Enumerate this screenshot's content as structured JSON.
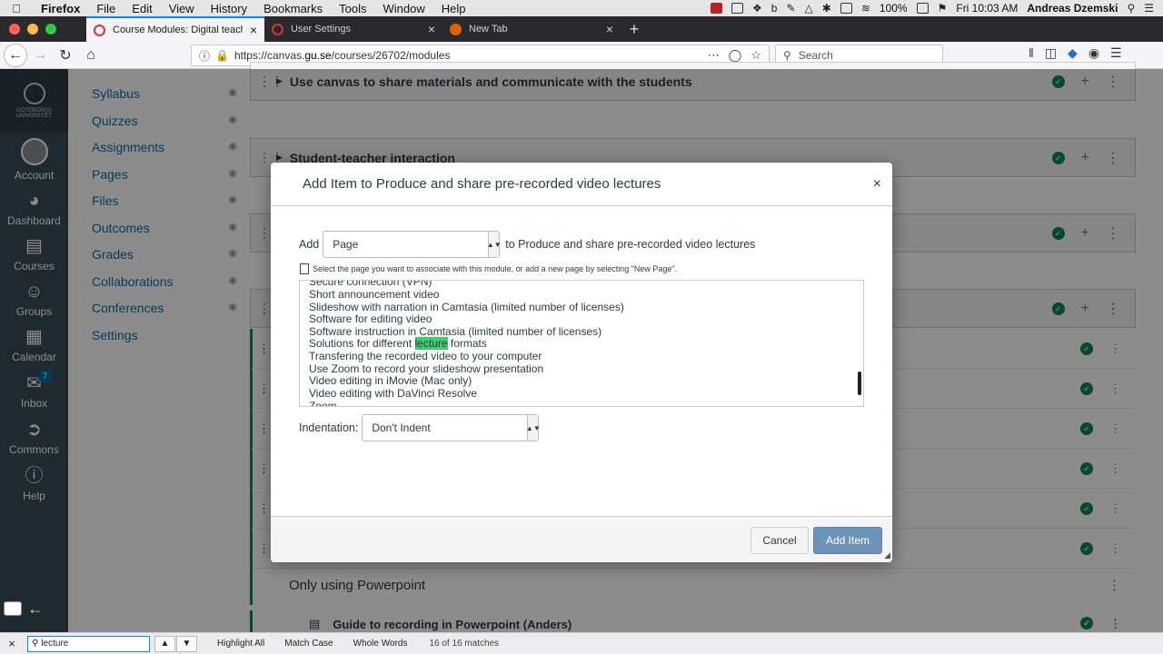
{
  "menubar": {
    "app": "Firefox",
    "items": [
      "File",
      "Edit",
      "View",
      "History",
      "Bookmarks",
      "Tools",
      "Window",
      "Help"
    ],
    "battery": "100%",
    "clock": "Fri 10:03 AM",
    "user": "Andreas Dzemski"
  },
  "tabs": [
    {
      "title": "Course Modules: Digital teachin",
      "active": true
    },
    {
      "title": "User Settings",
      "active": false
    },
    {
      "title": "New Tab",
      "active": false
    }
  ],
  "navbar": {
    "url_prefix": "https://canvas.",
    "url_host": "gu.se",
    "url_path": "/courses/26702/modules",
    "search_placeholder": "Search"
  },
  "global_nav": {
    "logo_text": "GÖTEBORGS UNIVERSITET",
    "items": [
      {
        "label": "Account",
        "icon": "avatar"
      },
      {
        "label": "Dashboard",
        "icon": "dashboard-icon"
      },
      {
        "label": "Courses",
        "icon": "courses-icon"
      },
      {
        "label": "Groups",
        "icon": "groups-icon"
      },
      {
        "label": "Calendar",
        "icon": "calendar-icon"
      },
      {
        "label": "Inbox",
        "icon": "inbox-icon",
        "badge": "7"
      },
      {
        "label": "Commons",
        "icon": "commons-icon"
      },
      {
        "label": "Help",
        "icon": "help-icon"
      }
    ]
  },
  "course_nav": {
    "items": [
      {
        "label": "Syllabus",
        "hidden": true
      },
      {
        "label": "Quizzes",
        "hidden": true
      },
      {
        "label": "Assignments",
        "hidden": true
      },
      {
        "label": "Pages",
        "hidden": true
      },
      {
        "label": "Files",
        "hidden": true
      },
      {
        "label": "Outcomes",
        "hidden": true
      },
      {
        "label": "Grades",
        "hidden": true
      },
      {
        "label": "Collaborations",
        "hidden": true
      },
      {
        "label": "Conferences",
        "hidden": true
      },
      {
        "label": "Settings",
        "hidden": false
      }
    ]
  },
  "modules": {
    "headers": [
      "Use canvas to share materials and communicate with the students",
      "Student-teacher interaction"
    ],
    "subheader": "Only using Powerpoint",
    "subitem": "Guide to recording in Powerpoint (Anders)"
  },
  "dialog": {
    "title": "Add Item to Produce and share pre-recorded video lectures",
    "close": "×",
    "add_label": "Add",
    "type_value": "Page",
    "add_suffix": "to Produce and share pre-recorded video lectures",
    "hint": "Select the page you want to associate with this module, or add a new page by selecting \"New Page\".",
    "options": [
      "Secure connection (VPN)",
      "Short announcement video",
      "Slideshow with narration in Camtasia (limited number of licenses)",
      "Software for editing video",
      "Software instruction in Camtasia (limited number of licenses)",
      "Solutions for different lecture formats",
      "Transfering the recorded video to your computer",
      "Use Zoom to record your slideshow presentation",
      "Video editing in iMovie (Mac only)",
      "Video editing with DaVinci Resolve",
      "Zoom"
    ],
    "highlight": {
      "before": "Solutions for different ",
      "match": "lecture",
      "after": " formats"
    },
    "indent_label": "Indentation:",
    "indent_value": "Don't Indent",
    "cancel": "Cancel",
    "submit": "Add Item"
  },
  "findbar": {
    "query": "lecture",
    "highlight_all": "Highlight All",
    "match_case": "Match Case",
    "whole_words": "Whole Words",
    "matches": "16 of 16 matches"
  },
  "colors": {
    "canvas_nav": "#394b58",
    "link": "#0770a3",
    "published": "#0b874b",
    "primary_button": "#6d93b8",
    "find_highlight": "#38d06a"
  }
}
